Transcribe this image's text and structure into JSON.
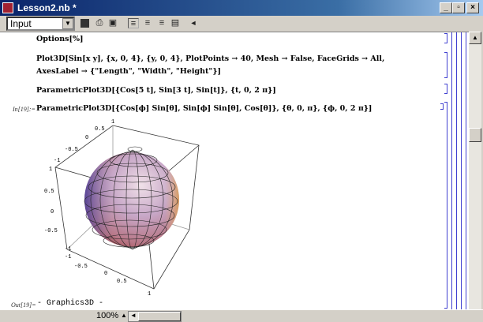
{
  "window": {
    "title": "Lesson2.nb *",
    "minimize": "_",
    "maximize": "▫",
    "close": "×"
  },
  "toolbar": {
    "style_value": "Input",
    "dropdown": "▼",
    "icons": [
      "save-icon",
      "print-icon",
      "inspector-icon",
      "align-left-icon",
      "align-center-icon",
      "align-right-icon",
      "justify-icon",
      "collapse-arrow-icon"
    ]
  },
  "cells": [
    {
      "text": "Options[%]"
    },
    {
      "text": "Plot3D[Sin[x y], {x, 0, 4}, {y, 0, 4}, PlotPoints → 40, Mesh → False, FaceGrids → All,",
      "text2": " AxesLabel → {\"Length\", \"Width\", \"Height\"}]"
    },
    {
      "text": "ParametricPlot3D[{Cos[5 t], Sin[3 t], Sin[t]}, {t, 0, 2 π}]"
    },
    {
      "label": "In[19]:=",
      "text": "ParametricPlot3D[{Cos[ϕ] Sin[θ], Sin[ϕ] Sin[θ], Cos[θ]}, {θ, 0, π}, {ϕ, 0, 2 π}]"
    }
  ],
  "output": {
    "label": "Out[19]=",
    "text": "- Graphics3D -"
  },
  "plot": {
    "ticks_top": [
      "1",
      "0.5",
      "0",
      "-0.5",
      "-1"
    ],
    "ticks_left": [
      "1",
      "0.5",
      "0",
      "-0.5",
      "-1"
    ],
    "ticks_bottom": [
      "-1",
      "-0.5",
      "0",
      "0.5",
      "1"
    ]
  },
  "status": {
    "zoom": "100%",
    "zoom_arrow": "▲",
    "scroll_left": "◄"
  },
  "scrollbar": {
    "up": "▲"
  }
}
